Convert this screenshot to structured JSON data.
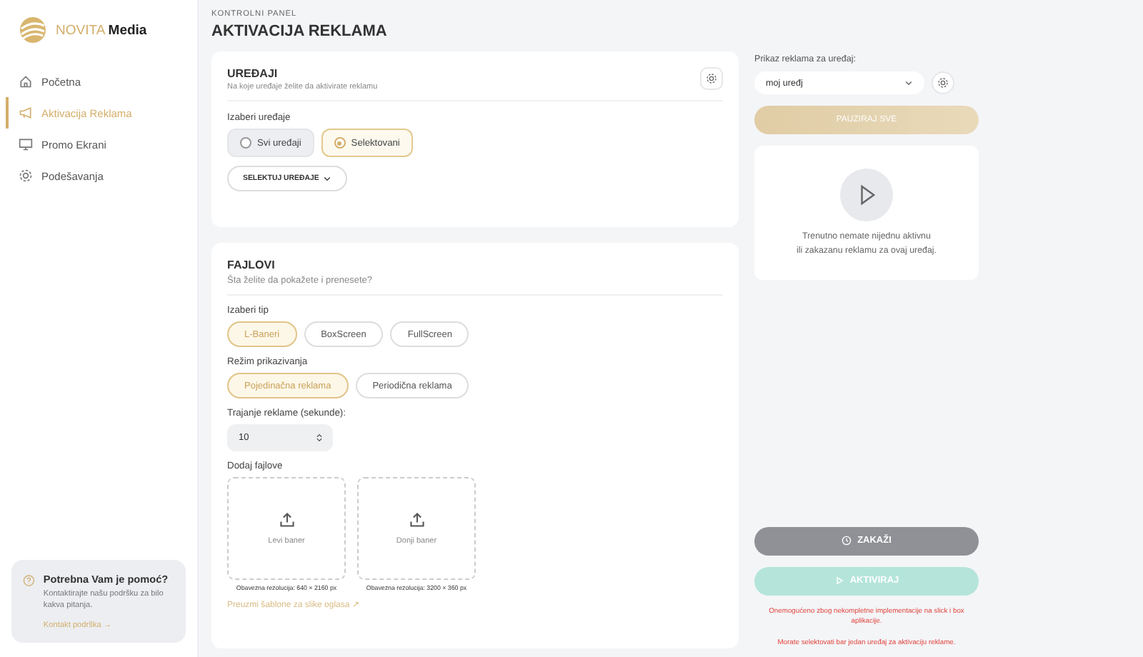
{
  "brand": {
    "name": "NOVITA",
    "suffix": "Media"
  },
  "nav": [
    {
      "label": "Početna",
      "kind": "home",
      "selected": false
    },
    {
      "label": "Aktivacija Reklama",
      "kind": "megaphone",
      "selected": true
    },
    {
      "label": "Promo Ekrani",
      "kind": "monitor",
      "selected": false
    },
    {
      "label": "Podešavanja",
      "kind": "gear",
      "selected": false
    }
  ],
  "help": {
    "title": "Potrebna Vam je pomoć?",
    "text": "Kontaktirajte našu podršku za bilo kakva pitanja.",
    "link": "Kontakt podrška →"
  },
  "header": {
    "breadcrumb": "KONTROLNI PANEL",
    "title": "AKTIVACIJA REKLAMA"
  },
  "devices": {
    "title": "UREĐAJI",
    "subtitle": "Na koje uređaje želite da aktivirate reklamu",
    "label": "Izaberi uređaje",
    "options": [
      {
        "label": "Svi uređaji",
        "selected": false
      },
      {
        "label": "Selektovani",
        "selected": true
      }
    ],
    "select_button": "SELEKTUJ UREĐAJE"
  },
  "files": {
    "title": "FAJLOVI",
    "subtitle": "Šta želite da pokažete i prenesete?",
    "type_label": "Izaberi tip",
    "types": [
      {
        "label": "L-Baneri",
        "selected": true
      },
      {
        "label": "BoxScreen",
        "selected": false
      },
      {
        "label": "FullScreen",
        "selected": false
      }
    ],
    "mode_label": "Režim prikazivanja",
    "modes": [
      {
        "label": "Pojedinačna reklama",
        "selected": true
      },
      {
        "label": "Periodična reklama",
        "selected": false
      }
    ],
    "duration_label": "Trajanje reklame (sekunde):",
    "duration_value": "10",
    "add_label": "Dodaj fajlove",
    "uploads": [
      {
        "label": "Levi baner",
        "note": "Obavezna rezolucija: 640 × 2160 px"
      },
      {
        "label": "Donji baner",
        "note": "Obavezna rezolucija: 3200 × 360 px"
      }
    ],
    "template_link": "Preuzmi šablone za slike oglasa ↗"
  },
  "preview": {
    "label": "Prikaz reklama za uređaj:",
    "device": "moj uređj",
    "pause_button": {
      "label": "PAUZIRAJ SVE",
      "disabled": true
    },
    "empty_lines": [
      "Trenutno nemate nijednu aktivnu",
      "ili zakazanu reklamu za ovaj uređaj."
    ]
  },
  "schedule_button": {
    "label": "ZAKAŽI",
    "disabled": false
  },
  "activate_button": {
    "label": "AKTIVIRAJ",
    "disabled": true
  },
  "errors": [
    "Onemogućeno zbog nekompletne implementacije na slick i box aplikacije.",
    "Morate selektovati bar jedan uređaj za aktivaciju reklame."
  ]
}
